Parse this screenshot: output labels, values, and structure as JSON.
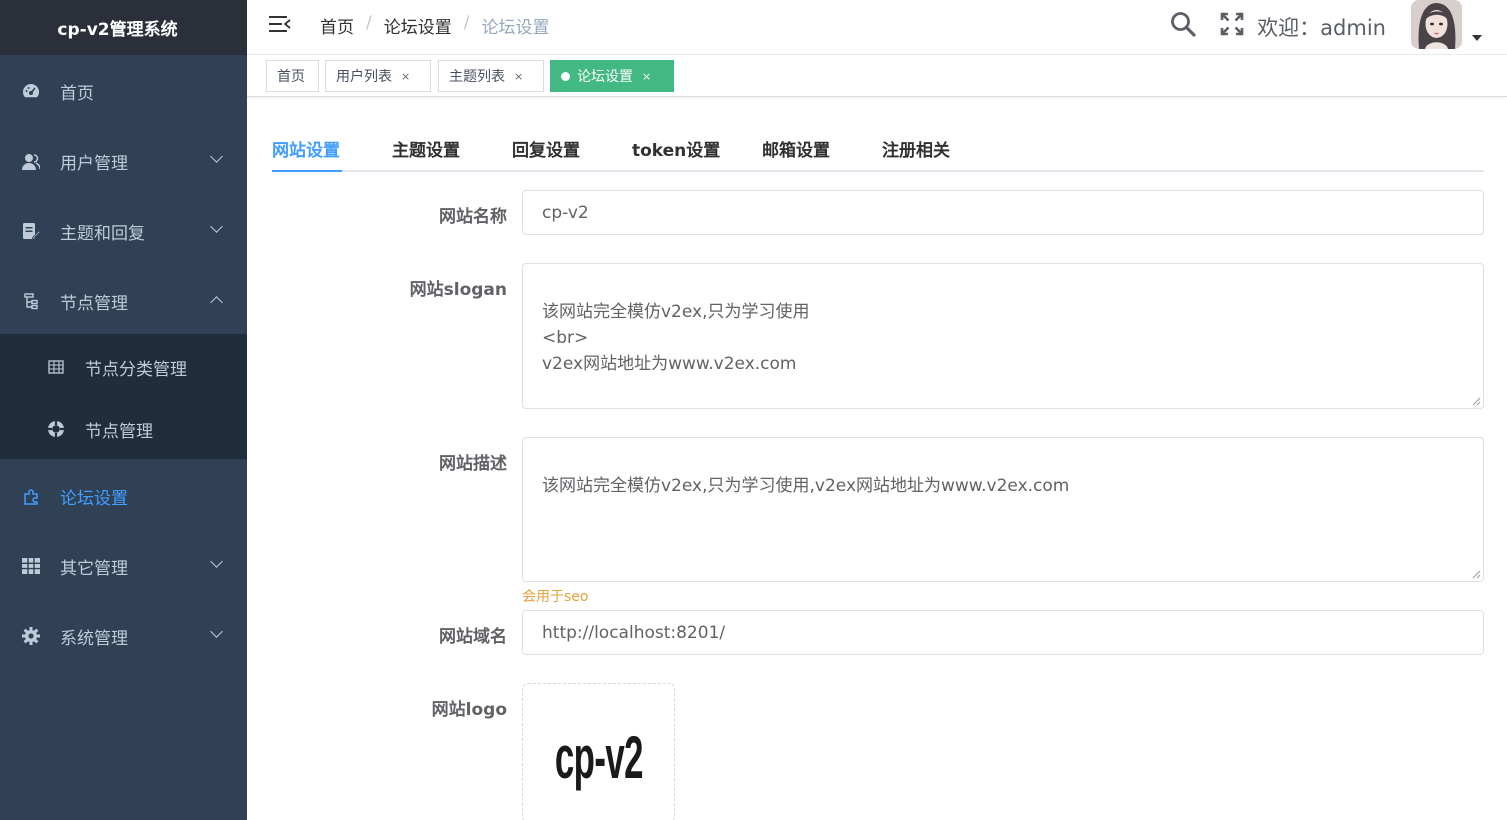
{
  "app": {
    "title": "cp-v2管理系统"
  },
  "sidebar": {
    "items": [
      {
        "label": "首页",
        "icon": "dashboard-icon"
      },
      {
        "label": "用户管理",
        "icon": "user-icon"
      },
      {
        "label": "主题和回复",
        "icon": "document-edit-icon"
      },
      {
        "label": "节点管理",
        "icon": "tree-icon"
      },
      {
        "label": "论坛设置",
        "icon": "puzzle-icon"
      },
      {
        "label": "其它管理",
        "icon": "table-grid-icon"
      },
      {
        "label": "系统管理",
        "icon": "gear-icon"
      }
    ],
    "subitems": [
      {
        "label": "节点分类管理",
        "icon": "table-icon"
      },
      {
        "label": "节点管理",
        "icon": "lifebuoy-icon"
      }
    ],
    "active_color": "#409eff",
    "background": "#304156"
  },
  "header": {
    "breadcrumb": [
      "首页",
      "论坛设置",
      "论坛设置"
    ],
    "welcome": "欢迎：admin"
  },
  "tags": [
    {
      "label": "首页"
    },
    {
      "label": "用户列表",
      "close": "×"
    },
    {
      "label": "主题列表",
      "close": "×"
    },
    {
      "label": "论坛设置",
      "close": "×",
      "active": true
    }
  ],
  "tabs": [
    "网站设置",
    "主题设置",
    "回复设置",
    "token设置",
    "邮箱设置",
    "注册相关"
  ],
  "form": {
    "site_name_label": "网站名称",
    "site_name_value": "cp-v2",
    "slogan_label": "网站slogan",
    "slogan_value": "该网站完全模仿v2ex,只为学习使用\n<br>\nv2ex网站地址为www.v2ex.com",
    "desc_label": "网站描述",
    "desc_value": "该网站完全模仿v2ex,只为学习使用,v2ex网站地址为www.v2ex.com",
    "desc_hint": "会用于seo",
    "domain_label": "网站域名",
    "domain_value": "http://localhost:8201/",
    "logo_label": "网站logo",
    "logo_text": "cp-v2"
  }
}
